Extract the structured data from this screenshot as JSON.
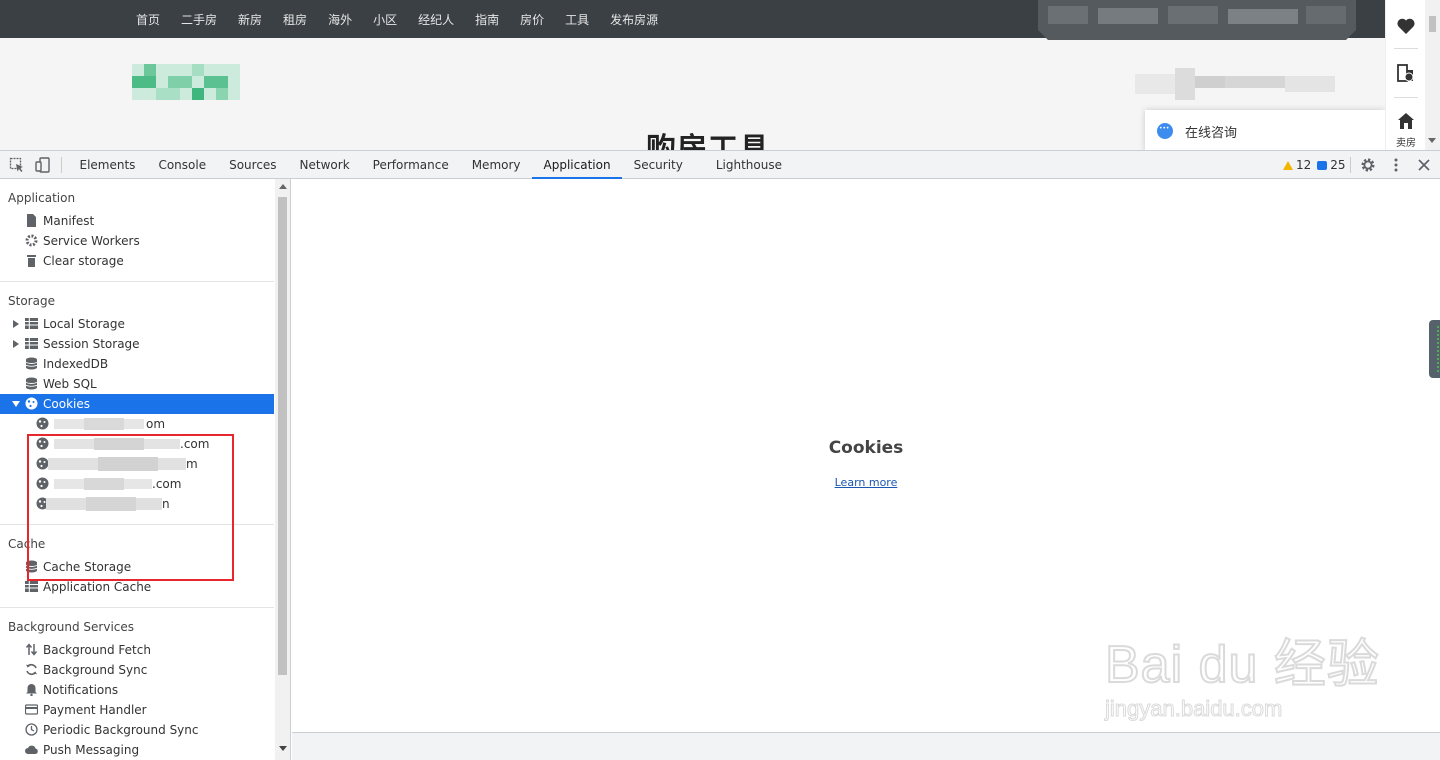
{
  "site": {
    "nav_links": [
      "首页",
      "二手房",
      "新房",
      "租房",
      "海外",
      "小区",
      "经纪人",
      "指南",
      "房价",
      "工具",
      "发布房源"
    ],
    "heading": "购房工具",
    "consult_label": "在线咨询",
    "side_rail": {
      "sell_label": "卖房"
    }
  },
  "devtools": {
    "tabs": [
      {
        "label": "Elements"
      },
      {
        "label": "Console"
      },
      {
        "label": "Sources"
      },
      {
        "label": "Network"
      },
      {
        "label": "Performance"
      },
      {
        "label": "Memory"
      },
      {
        "label": "Application",
        "active": true
      },
      {
        "label": "Security"
      },
      {
        "label": "Lighthouse"
      }
    ],
    "issues": {
      "warnings": "12",
      "messages": "25"
    },
    "sidebar": {
      "application": {
        "title": "Application",
        "items": [
          {
            "label": "Manifest",
            "icon": "file-icon"
          },
          {
            "label": "Service Workers",
            "icon": "gear-icon"
          },
          {
            "label": "Clear storage",
            "icon": "trash-icon"
          }
        ]
      },
      "storage": {
        "title": "Storage",
        "items": [
          {
            "label": "Local Storage",
            "icon": "grid-icon",
            "expandable": true
          },
          {
            "label": "Session Storage",
            "icon": "grid-icon",
            "expandable": true
          },
          {
            "label": "IndexedDB",
            "icon": "database-icon"
          },
          {
            "label": "Web SQL",
            "icon": "database-icon"
          },
          {
            "label": "Cookies",
            "icon": "cookie-icon",
            "expanded": true,
            "selected": true
          }
        ],
        "cookie_domains": [
          "om",
          ".com",
          "m",
          ".com",
          "n"
        ]
      },
      "cache": {
        "title": "Cache",
        "items": [
          {
            "label": "Cache Storage",
            "icon": "database-icon"
          },
          {
            "label": "Application Cache",
            "icon": "grid-icon"
          }
        ]
      },
      "background": {
        "title": "Background Services",
        "items": [
          {
            "label": "Background Fetch",
            "icon": "arrows-updown-icon"
          },
          {
            "label": "Background Sync",
            "icon": "sync-icon"
          },
          {
            "label": "Notifications",
            "icon": "bell-icon"
          },
          {
            "label": "Payment Handler",
            "icon": "card-icon"
          },
          {
            "label": "Periodic Background Sync",
            "icon": "clock-icon"
          },
          {
            "label": "Push Messaging",
            "icon": "cloud-icon"
          }
        ]
      }
    },
    "main": {
      "title": "Cookies",
      "learn_more": "Learn more"
    }
  },
  "watermark": {
    "main": "Bai du 经验",
    "sub": "jingyan.baidu.com"
  },
  "colors": {
    "accent": "#1a73e8",
    "highlight": "#e8262d",
    "nav_bg": "#3b4045"
  }
}
